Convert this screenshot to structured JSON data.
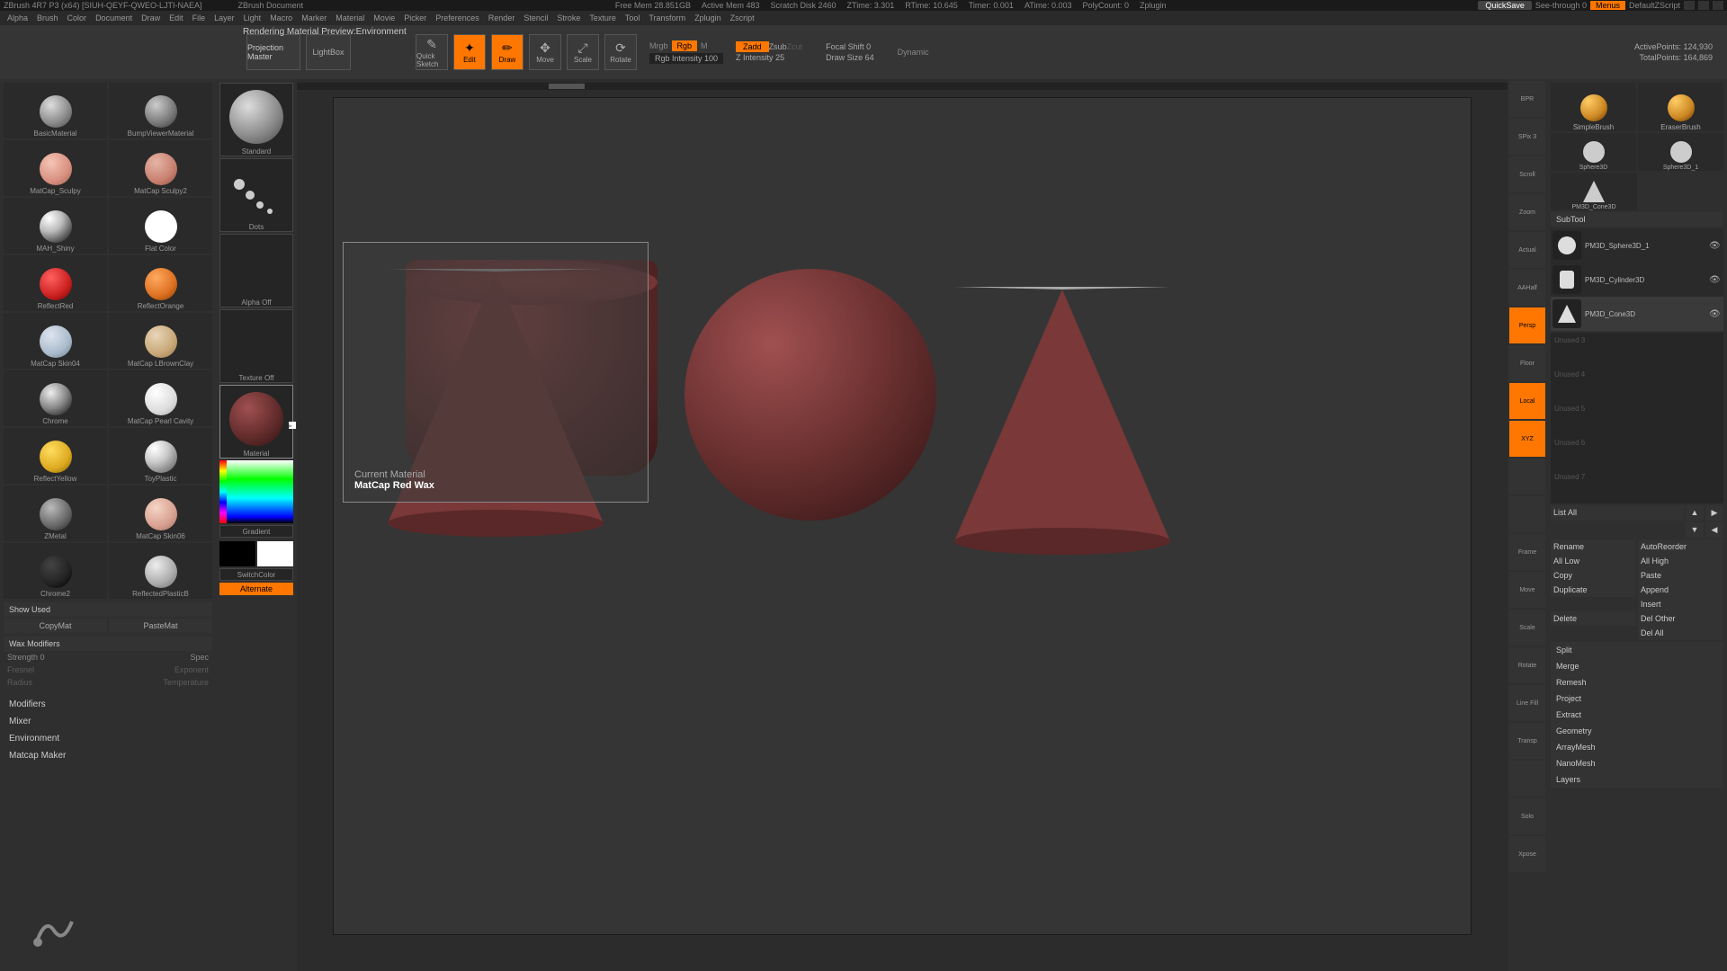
{
  "titlebar": {
    "app": "ZBrush 4R7 P3 (x64) [SIUH-QEYF-QWEO-LJTI-NAEA]",
    "doc": "ZBrush Document",
    "stats": [
      "Free Mem 28.851GB",
      "Active Mem 483",
      "Scratch Disk 2460",
      "ZTime: 3.301",
      "RTime: 10.645",
      "Timer: 0.001",
      "ATime: 0.003",
      "PolyCount: 0",
      "Zplugin"
    ],
    "quicksave": "QuickSave",
    "seethrough": "See-through  0",
    "menus": "Menus",
    "script": "DefaultZScript"
  },
  "menubar": [
    "Alpha",
    "Brush",
    "Color",
    "Document",
    "Draw",
    "Edit",
    "File",
    "Layer",
    "Light",
    "Macro",
    "Marker",
    "Material",
    "Movie",
    "Picker",
    "Preferences",
    "Render",
    "Stencil",
    "Stroke",
    "Texture",
    "Tool",
    "Transform",
    "Zplugin",
    "Zscript"
  ],
  "status_line": "Rendering Material Preview:Environment",
  "toolbar": {
    "projection": "Projection Master",
    "lightbox": "LightBox",
    "quicksketch": "Quick Sketch",
    "edit": "Edit",
    "draw": "Draw",
    "move": "Move",
    "scale": "Scale",
    "rotate": "Rotate",
    "mrgb": "Mrgb",
    "rgb": "Rgb",
    "m": "M",
    "rgb_intensity": "Rgb Intensity 100",
    "zadd": "Zadd",
    "zsub": "Zsub",
    "zcut": "Zcut",
    "z_intensity": "Z Intensity 25",
    "focal_shift": "Focal Shift 0",
    "draw_size": "Draw Size 64",
    "dynamic": "Dynamic",
    "active_points": "ActivePoints: 124,930",
    "total_points": "TotalPoints: 164,869"
  },
  "materials": [
    {
      "name": "BasicMaterial",
      "bg": "radial-gradient(circle at 35% 30%, #ddd, #888 60%, #444)"
    },
    {
      "name": "BumpViewerMaterial",
      "bg": "radial-gradient(circle at 35% 30%, #ccc, #777 60%, #333)"
    },
    {
      "name": "MatCap_Sculpy",
      "bg": "radial-gradient(circle at 35% 30%, #f5c5b5, #d89080 60%, #a06050)"
    },
    {
      "name": "MatCap Sculpy2",
      "bg": "radial-gradient(circle at 35% 30%, #e5b5a5, #c88070 60%, #905040)"
    },
    {
      "name": "MAH_Shiny",
      "bg": "radial-gradient(circle at 30% 25%, #fff, #bbb 40%, #222 90%)"
    },
    {
      "name": "Flat Color",
      "bg": "#fff"
    },
    {
      "name": "ReflectRed",
      "bg": "radial-gradient(circle at 35% 30%, #ff6060, #cc2020 60%, #600)"
    },
    {
      "name": "ReflectOrange",
      "bg": "radial-gradient(circle at 35% 30%, #ffaa60, #dd7020 60%, #803800)"
    },
    {
      "name": "MatCap Skin04",
      "bg": "radial-gradient(circle at 35% 30%, #dde5ee, #aabbcc 60%, #667788)"
    },
    {
      "name": "MatCap LBrownClay",
      "bg": "radial-gradient(circle at 35% 30%, #e8d5b8, #c8a878 60%, #987848)"
    },
    {
      "name": "Chrome",
      "bg": "radial-gradient(circle at 35% 30%, #eee, #888 50%, #222 90%)"
    },
    {
      "name": "MatCap Pearl Cavity",
      "bg": "radial-gradient(circle at 35% 30%, #fff, #ddd 60%, #aaa)"
    },
    {
      "name": "ReflectYellow",
      "bg": "radial-gradient(circle at 35% 30%, #ffdd60, #ddaa20 60%, #806000)"
    },
    {
      "name": "ToyPlastic",
      "bg": "radial-gradient(circle at 30% 25%, #fff, #ccc 40%, #666 90%)"
    },
    {
      "name": "ZMetal",
      "bg": "radial-gradient(circle at 35% 30%, #bbb, #666 60%, #222)"
    },
    {
      "name": "MatCap Skin06",
      "bg": "radial-gradient(circle at 35% 30%, #f5d5c5, #d8a090 60%, #a07060)"
    },
    {
      "name": "Chrome2",
      "bg": "radial-gradient(circle at 35% 30%, #444, #222 60%, #000)"
    },
    {
      "name": "ReflectedPlasticB",
      "bg": "radial-gradient(circle at 35% 30%, #eee, #aaa 60%, #666)"
    }
  ],
  "left_buttons": {
    "show_used": "Show Used",
    "copymat": "CopyMat",
    "pastemat": "PasteMat",
    "wax_modifiers": "Wax Modifiers",
    "strength": "Strength 0",
    "spec": "Spec",
    "fresnel": "Fresnel",
    "exponent": "Exponent",
    "radius": "Radius",
    "temperature": "Temperature",
    "modifiers": "Modifiers",
    "mixer": "Mixer",
    "environment": "Environment",
    "matcap_maker": "Matcap Maker"
  },
  "tool_col": {
    "standard": "Standard",
    "dots": "Dots",
    "alpha_off": "Alpha Off",
    "texture_off": "Texture Off",
    "material": "Material",
    "gradient": "Gradient",
    "switchcolor": "SwitchColor",
    "alternate": "Alternate"
  },
  "tooltip": {
    "label": "Current Material",
    "value": "MatCap Red Wax"
  },
  "right_strip": [
    "BPR",
    "SPix 3",
    "Scroll",
    "Zoom",
    "Actual",
    "AAHalf",
    "Persp",
    "Floor",
    "Local",
    "XYZ",
    "",
    "",
    "Frame",
    "Move",
    "Scale",
    "Rotate",
    "Line Fill",
    "Transp",
    "",
    "Solo",
    "Xpose"
  ],
  "right_panel": {
    "brushes": [
      {
        "name": "SimpleBrush",
        "bg": "radial-gradient(circle at 30% 25%, #ffcc66, #cc8822 60%, #663300)"
      },
      {
        "name": "EraserBrush",
        "bg": "radial-gradient(circle at 30% 25%, #ffcc66, #cc8822 60%, #663300)"
      }
    ],
    "tools": [
      {
        "name": "Sphere3D",
        "shape": "sphere"
      },
      {
        "name": "Sphere3D_1",
        "shape": "sphere"
      },
      {
        "name": "PM3D_Cone3D",
        "shape": "cone"
      }
    ],
    "subtool_hdr": "SubTool",
    "subtools": [
      {
        "name": "PM3D_Sphere3D_1",
        "active": false,
        "visible": true
      },
      {
        "name": "PM3D_Cylinder3D",
        "active": false,
        "visible": true
      },
      {
        "name": "PM3D_Cone3D",
        "active": true,
        "visible": true
      }
    ],
    "empty_slots": [
      "Unused 3",
      "Unused 4",
      "Unused 5",
      "Unused 6",
      "Unused 7"
    ],
    "list_all": "List All",
    "actions": [
      [
        "Rename",
        "AutoReorder"
      ],
      [
        "All Low",
        "All High"
      ],
      [
        "Copy",
        "Paste"
      ],
      [
        "Duplicate",
        "Append"
      ],
      [
        "",
        "Insert"
      ],
      [
        "Delete",
        "Del Other"
      ],
      [
        "",
        "Del All"
      ]
    ],
    "sections": [
      "Split",
      "Merge",
      "Remesh",
      "Project",
      "Extract",
      "Geometry",
      "ArrayMesh",
      "NanoMesh",
      "Layers"
    ]
  }
}
